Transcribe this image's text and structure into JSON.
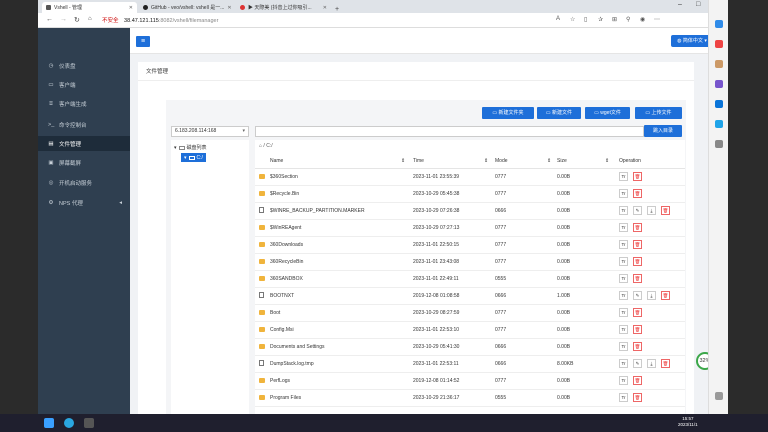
{
  "browser": {
    "tabs": [
      {
        "label": "Vshell - 管理"
      },
      {
        "label": "GitHub - veo/vshell: vshell 是一..."
      },
      {
        "label": "▶ 天際美 (抖音上过你吸引..."
      }
    ],
    "new_tab": "+",
    "url_warning": "不安全",
    "url_host": "38.47.121.115",
    "url_path": ":8082/vshell/filemanager"
  },
  "app": {
    "menu_icon": "≡",
    "lang_button": "简体中文",
    "logout": "退出",
    "sidebar": [
      {
        "label": "仪表盘",
        "icon": "◷"
      },
      {
        "label": "客户端",
        "icon": "▭"
      },
      {
        "label": "客户端生成",
        "icon": "⌸"
      },
      {
        "label": "命令控制台",
        "icon": ">_"
      },
      {
        "label": "文件管理",
        "icon": "▤",
        "active": true
      },
      {
        "label": "屏幕截屏",
        "icon": "▣"
      },
      {
        "label": "开机启动服务",
        "icon": "◎"
      },
      {
        "label": "NPS 代理",
        "icon": "⚙",
        "chevron": "◂"
      }
    ],
    "panel_title": "文件管理",
    "buttons": {
      "new_folder": "新建文件夹",
      "new_file": "新建文件",
      "wget": "wget文件",
      "upload": "上传文件",
      "goto_dir": "跳入目录"
    },
    "ip_select": "6.183.208.114:168",
    "tree": {
      "root": "磁盘列表",
      "child": "C:/"
    },
    "breadcrumb": "/ C:/",
    "columns": {
      "name": "Name",
      "time": "Time",
      "mode": "Mode",
      "size": "Size",
      "operation": "Operation"
    },
    "files": [
      {
        "type": "folder",
        "name": "$360Section",
        "time": "2023-11-01 23:55:39",
        "mode": "0777",
        "size": "0.00B"
      },
      {
        "type": "folder",
        "name": "$Recycle.Bin",
        "time": "2023-10-29 05:45:38",
        "mode": "0777",
        "size": "0.00B"
      },
      {
        "type": "file",
        "name": "$WINRE_BACKUP_PARTITION.MARKER",
        "time": "2023-10-29 07:26:38",
        "mode": "0666",
        "size": "0.00B"
      },
      {
        "type": "folder",
        "name": "$WinREAgent",
        "time": "2023-10-29 07:27:13",
        "mode": "0777",
        "size": "0.00B"
      },
      {
        "type": "folder",
        "name": "360Downloads",
        "time": "2023-11-01 22:50:15",
        "mode": "0777",
        "size": "0.00B"
      },
      {
        "type": "folder",
        "name": "360RecycleBin",
        "time": "2023-11-01 23:43:08",
        "mode": "0777",
        "size": "0.00B"
      },
      {
        "type": "folder",
        "name": "360SANDBOX",
        "time": "2023-11-01 22:49:11",
        "mode": "0555",
        "size": "0.00B"
      },
      {
        "type": "file",
        "name": "BOOTNXT",
        "time": "2019-12-08 01:08:58",
        "mode": "0666",
        "size": "1.00B"
      },
      {
        "type": "folder",
        "name": "Boot",
        "time": "2023-10-29 08:27:59",
        "mode": "0777",
        "size": "0.00B"
      },
      {
        "type": "folder",
        "name": "Config.Msi",
        "time": "2023-11-01 22:53:10",
        "mode": "0777",
        "size": "0.00B"
      },
      {
        "type": "folder",
        "name": "Documents and Settings",
        "time": "2023-10-29 05:41:30",
        "mode": "0666",
        "size": "0.00B"
      },
      {
        "type": "file",
        "name": "DumpStack.log.tmp",
        "time": "2023-11-01 22:53:11",
        "mode": "0666",
        "size": "8.00KB"
      },
      {
        "type": "folder",
        "name": "PerfLogs",
        "time": "2019-12-08 01:14:52",
        "mode": "0777",
        "size": "0.00B"
      },
      {
        "type": "folder",
        "name": "Program Files",
        "time": "2023-10-29 21:36:17",
        "mode": "0555",
        "size": "0.00B"
      }
    ],
    "speed_percent": "32%",
    "speed_info": [
      "0K/s",
      "CPU 49°C"
    ]
  },
  "taskbar": {
    "time": "15:57",
    "date": "2023/11/1"
  }
}
